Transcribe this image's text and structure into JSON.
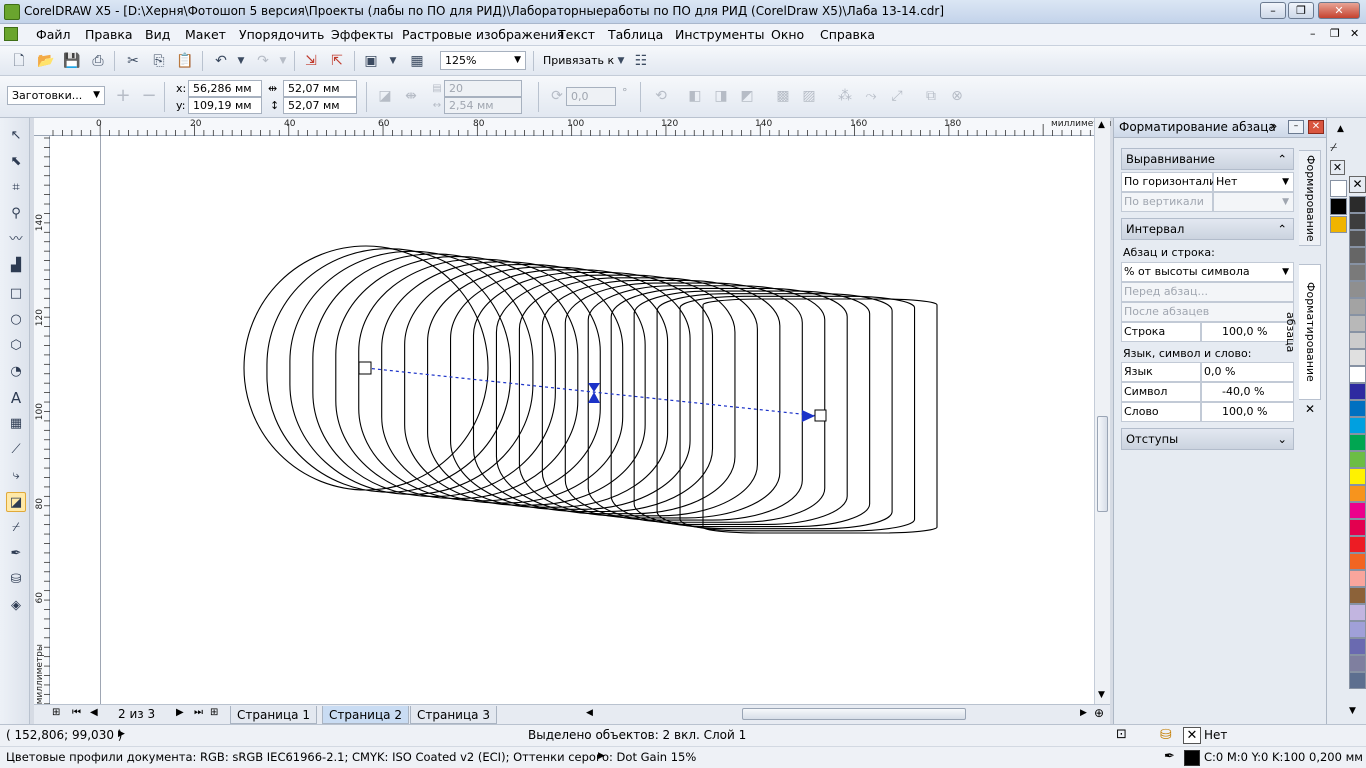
{
  "titlebar": {
    "title": "CorelDRAW X5 - [D:\\Херня\\Фотошоп 5 версия\\Проекты (лабы по ПО для РИД)\\Лабораторныеработы по ПО для РИД (CorelDraw X5)\\Лаба 13-14.cdr]",
    "minimize": "–",
    "restore": "❐",
    "close": "✕"
  },
  "menu": {
    "items": [
      "Файл",
      "Правка",
      "Вид",
      "Макет",
      "Упорядочить",
      "Эффекты",
      "Растровые изображения",
      "Текст",
      "Таблица",
      "Инструменты",
      "Окно",
      "Справка"
    ],
    "doc_min": "–",
    "doc_restore": "❐",
    "doc_close": "✕"
  },
  "toolbar1": {
    "zoom": "125%",
    "snap_label": "Привязать к"
  },
  "toolbar2": {
    "presets": "Заготовки...",
    "x_label": "x:",
    "x_value": "56,286 мм",
    "y_label": "y:",
    "y_value": "109,19 мм",
    "w_value": "52,07 мм",
    "h_value": "52,07 мм",
    "steps_value": "20",
    "spacing_value": "2,54 мм",
    "angle_value": "0,0",
    "angle_unit": "°"
  },
  "ruler": {
    "unit_label": "миллиметры",
    "h_ticks": [
      "0",
      "20",
      "40",
      "60",
      "80",
      "100",
      "120",
      "140",
      "160",
      "180"
    ],
    "v_ticks": [
      "140",
      "120",
      "100",
      "80",
      "60"
    ]
  },
  "pages": {
    "counter": "2 из 3",
    "tabs": [
      "Страница 1",
      "Страница 2",
      "Страница 3"
    ],
    "active_index": 1
  },
  "status": {
    "coords": "( 152,806; 99,030 )",
    "selection": "Выделено объектов: 2 вкл. Слой 1",
    "fill_label": "Нет",
    "color_profiles": "Цветовые профили документа: RGB: sRGB IEC61966-2.1; CMYK: ISO Coated v2 (ECI); Оттенки серого: Dot Gain 15%",
    "outline_label": "C:0 M:0 Y:0 K:100  0,200 мм"
  },
  "docker": {
    "title": "Форматирование абзаца",
    "align_section": "Выравнивание",
    "horiz_label": "По горизонтали",
    "horiz_value": "Нет",
    "vert_label": "По вертикали",
    "interval_section": "Интервал",
    "para_line_label": "Абзац и строка:",
    "percent_select": "% от высоты символа",
    "before_para": "Перед абзац...",
    "after_para": "После абзацев",
    "line_label": "Строка",
    "line_value": "100,0 %",
    "lang_symbol_word_label": "Язык, символ и слово:",
    "lang_label": "Язык",
    "lang_value": "0,0 %",
    "symbol_label": "Символ",
    "symbol_value": "-40,0 %",
    "word_label": "Слово",
    "word_value": "100,0 %",
    "indents_section": "Отступы",
    "tab_formatting": "Формирование",
    "tab_para_format": "Форматирование абзаца"
  },
  "palette": {
    "colors": [
      "#ffffff",
      "#000000",
      "#f0b400",
      "#2b2b2b",
      "#3d3d3d",
      "#525252",
      "#666666",
      "#7a7a7a",
      "#8f8f8f",
      "#a3a3a3",
      "#b8b8b8",
      "#cccccc",
      "#e0e0e0",
      "#ffffff",
      "#2e2aa0",
      "#0070c0",
      "#00a0e0",
      "#00a651",
      "#6cbd45",
      "#fff200",
      "#f7941d",
      "#ec008c",
      "#e3004f",
      "#ed1c24",
      "#f26522",
      "#f9a59c",
      "#8c6239",
      "#c2b5e0",
      "#a0a0d8",
      "#6a6ab0",
      "#7f7f9f",
      "#5d6f8f"
    ]
  }
}
